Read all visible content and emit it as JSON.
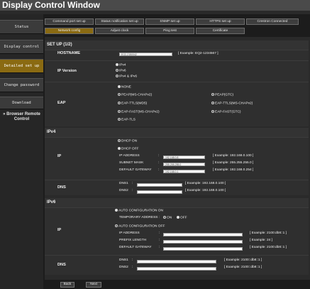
{
  "window": {
    "title": "Display Control Window"
  },
  "sidebar": {
    "items": [
      {
        "label": "Status"
      },
      {
        "label": "Display control"
      },
      {
        "label": "Detailed set up"
      },
      {
        "label": "Change password"
      },
      {
        "label": "Download"
      },
      {
        "label": "» Browser Remote Control"
      }
    ]
  },
  "tabs": {
    "row1": [
      "Command port set up",
      "Status notification set up",
      "SNMP set up",
      "HTTPS set up",
      "Crestron Connected"
    ],
    "row2": [
      "Network config",
      "Adjust clock",
      "Ping test",
      "Certificate"
    ]
  },
  "setup_heading": "SET UP (1/2)",
  "hostname": {
    "label": "HOSTNAME",
    "value": "EQ2-2150042",
    "example": "[ Example: EQ2-1234567 ]"
  },
  "ip_version": {
    "label": "IP Version",
    "options": [
      "IPv4",
      "IPv6",
      "IPv4 & IPv6"
    ]
  },
  "eap": {
    "label": "EAP",
    "options": [
      "NONE",
      "PEAP(MS-CHAPv2)",
      "PEAP(GTC)",
      "EAP-TTLS(MD5)",
      "EAP-TTLS(MS-CHAPv2)",
      "EAP-FAST(MS-CHAPv2)",
      "EAP-FAST(GTC)",
      "EAP-TLS"
    ]
  },
  "ipv4": {
    "heading": "IPv4",
    "ip_label": "IP",
    "dhcp_on": "DHCP ON",
    "dhcp_off": "DHCP OFF",
    "address_label": "IP ADDRESS",
    "address_value": "192.168.0.8",
    "address_example": "[ Example: 192.168.0.100 ]",
    "mask_label": "SUBNET MASK",
    "mask_value": "255.255.255.0",
    "mask_example": "[ Example: 255.255.255.0 ]",
    "gateway_label": "DEFAULT GATEWAY",
    "gateway_value": "192.168.0.1",
    "gateway_example": "[ Example: 192.168.0.254 ]",
    "dns_label": "DNS",
    "dns1_label": "DNS1",
    "dns1_example": "[ Example: 192.168.0.100 ]",
    "dns2_label": "DNS2",
    "dns2_example": "[ Example: 192.168.0.100 ]"
  },
  "ipv6": {
    "heading": "IPv6",
    "ip_label": "IP",
    "auto_on": "AUTO CONFIGURATION ON",
    "temp_label": "TEMPORARY ADDRESS",
    "temp_on": "ON",
    "temp_off": "OFF",
    "auto_off": "AUTO CONFIGURATION OFF",
    "address_label": "IP ADDRESS",
    "address_example": "[ Example: 2100:db8::1 ]",
    "prefix_label": "PREFIX LENGTH",
    "prefix_example": "[ Example: 24 ]",
    "gateway_label": "DEFAULT GATEWAY",
    "gateway_example": "[ Example: 2100:db8::1 ]",
    "dns_label": "DNS",
    "dns1_label": "DNS1",
    "dns1_example": "[ Example: 2100::db8::1 ]",
    "dns2_label": "DNS2",
    "dns2_example": "[ Example: 2100::db8::1 ]"
  },
  "buttons": {
    "back": "Back",
    "next": "Next"
  },
  "colors": {
    "accent": "#8a6a12",
    "background": "#1c1c1c",
    "panel": "#2a2a2a"
  }
}
